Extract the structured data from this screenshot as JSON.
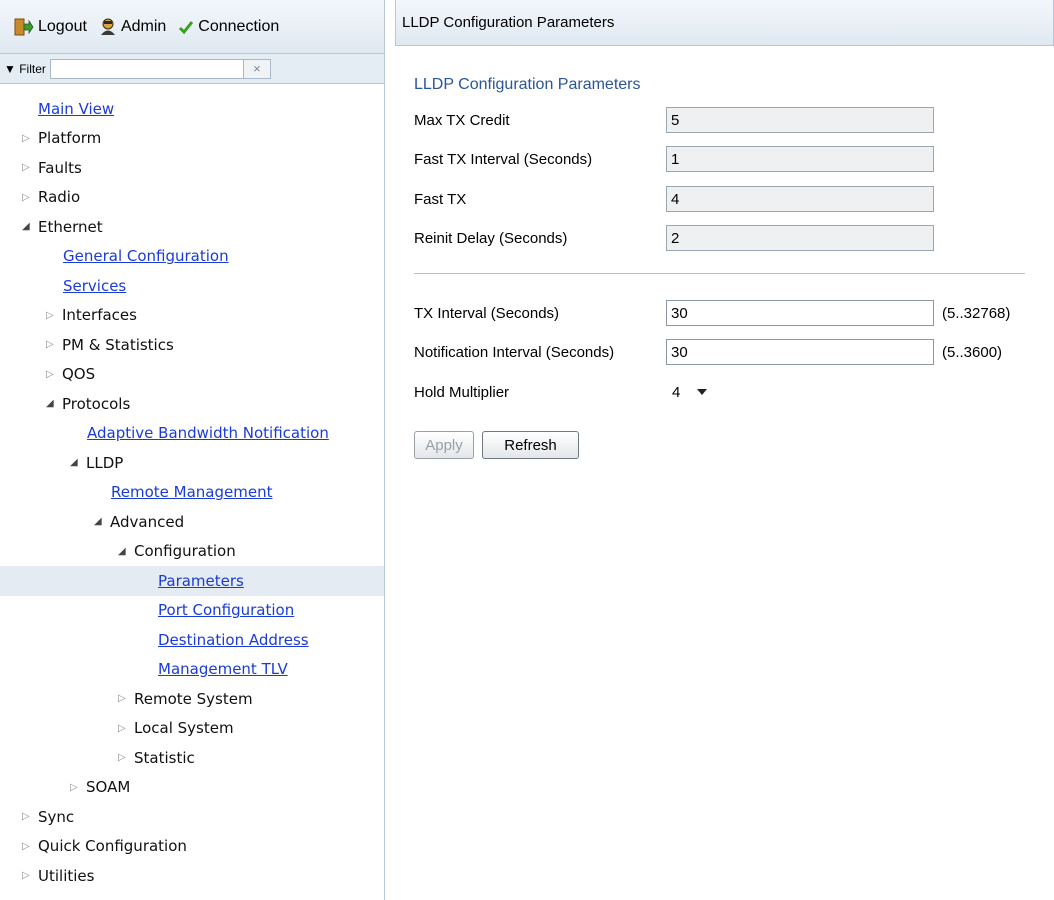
{
  "toolbar": {
    "logout": "Logout",
    "admin": "Admin",
    "connection": "Connection"
  },
  "filter": {
    "label": "Filter",
    "value": "",
    "clear": "×"
  },
  "tree": [
    {
      "label": "Main View",
      "level": 0,
      "arrow": "",
      "link": true,
      "name": "tree-item-main-view"
    },
    {
      "label": "Platform",
      "level": 0,
      "arrow": "closed",
      "link": false,
      "name": "tree-item-platform"
    },
    {
      "label": "Faults",
      "level": 0,
      "arrow": "closed",
      "link": false,
      "name": "tree-item-faults"
    },
    {
      "label": "Radio",
      "level": 0,
      "arrow": "closed",
      "link": false,
      "name": "tree-item-radio"
    },
    {
      "label": "Ethernet",
      "level": 0,
      "arrow": "open",
      "link": false,
      "name": "tree-item-ethernet"
    },
    {
      "label": "General Configuration",
      "level": 1,
      "arrow": "",
      "link": true,
      "name": "tree-item-general-configuration"
    },
    {
      "label": "Services",
      "level": 1,
      "arrow": "",
      "link": true,
      "name": "tree-item-services"
    },
    {
      "label": "Interfaces",
      "level": 1,
      "arrow": "closed",
      "link": false,
      "name": "tree-item-interfaces"
    },
    {
      "label": "PM & Statistics",
      "level": 1,
      "arrow": "closed",
      "link": false,
      "name": "tree-item-pm-statistics"
    },
    {
      "label": "QOS",
      "level": 1,
      "arrow": "closed",
      "link": false,
      "name": "tree-item-qos"
    },
    {
      "label": "Protocols",
      "level": 1,
      "arrow": "open",
      "link": false,
      "name": "tree-item-protocols"
    },
    {
      "label": "Adaptive Bandwidth Notification",
      "level": 2,
      "arrow": "",
      "link": true,
      "name": "tree-item-adaptive-bandwidth-notification"
    },
    {
      "label": "LLDP",
      "level": 2,
      "arrow": "open",
      "link": false,
      "name": "tree-item-lldp"
    },
    {
      "label": "Remote Management",
      "level": 3,
      "arrow": "",
      "link": true,
      "name": "tree-item-remote-management"
    },
    {
      "label": "Advanced",
      "level": 3,
      "arrow": "open",
      "link": false,
      "name": "tree-item-advanced"
    },
    {
      "label": "Configuration",
      "level": 4,
      "arrow": "open",
      "link": false,
      "name": "tree-item-configuration"
    },
    {
      "label": "Parameters",
      "level": 5,
      "arrow": "",
      "link": true,
      "selected": true,
      "name": "tree-item-parameters"
    },
    {
      "label": "Port Configuration",
      "level": 5,
      "arrow": "",
      "link": true,
      "name": "tree-item-port-configuration"
    },
    {
      "label": "Destination Address",
      "level": 5,
      "arrow": "",
      "link": true,
      "name": "tree-item-destination-address"
    },
    {
      "label": "Management TLV",
      "level": 5,
      "arrow": "",
      "link": true,
      "name": "tree-item-management-tlv"
    },
    {
      "label": "Remote System",
      "level": 4,
      "arrow": "closed",
      "link": false,
      "name": "tree-item-remote-system"
    },
    {
      "label": "Local System",
      "level": 4,
      "arrow": "closed",
      "link": false,
      "name": "tree-item-local-system"
    },
    {
      "label": "Statistic",
      "level": 4,
      "arrow": "closed",
      "link": false,
      "name": "tree-item-statistic"
    },
    {
      "label": "SOAM",
      "level": 2,
      "arrow": "closed",
      "link": false,
      "name": "tree-item-soam"
    },
    {
      "label": "Sync",
      "level": 0,
      "arrow": "closed",
      "link": false,
      "name": "tree-item-sync"
    },
    {
      "label": "Quick Configuration",
      "level": 0,
      "arrow": "closed",
      "link": false,
      "name": "tree-item-quick-configuration"
    },
    {
      "label": "Utilities",
      "level": 0,
      "arrow": "closed",
      "link": false,
      "name": "tree-item-utilities"
    }
  ],
  "main": {
    "header": "LLDP Configuration Parameters",
    "section_title": "LLDP Configuration Parameters",
    "readonly_fields": [
      {
        "label": "Max TX Credit",
        "value": "5"
      },
      {
        "label": "Fast TX Interval (Seconds)",
        "value": "1"
      },
      {
        "label": "Fast TX",
        "value": "4"
      },
      {
        "label": "Reinit Delay (Seconds)",
        "value": "2"
      }
    ],
    "tx_interval": {
      "label": "TX Interval (Seconds)",
      "value": "30",
      "range": "(5..32768)"
    },
    "notification_interval": {
      "label": "Notification Interval (Seconds)",
      "value": "30",
      "range": "(5..3600)"
    },
    "hold_multiplier": {
      "label": "Hold Multiplier",
      "value": "4"
    },
    "apply_label": "Apply",
    "refresh_label": "Refresh"
  }
}
